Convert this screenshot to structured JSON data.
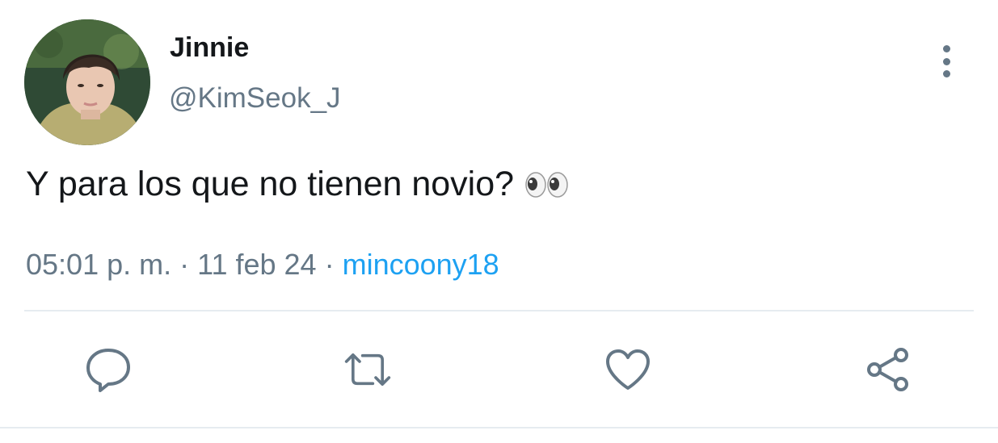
{
  "tweet": {
    "display_name": "Jinnie",
    "handle": "@KimSeok_J",
    "text": "Y para los que no tienen novio?",
    "text_emoji": "eyes-emoji",
    "time": "05:01 p. m.",
    "separator": "·",
    "date": "11 feb 24",
    "via": "mincoony18"
  },
  "icons": {
    "more": "more-vertical-icon",
    "reply": "reply-icon",
    "retweet": "retweet-icon",
    "like": "heart-icon",
    "share": "share-icon"
  },
  "colors": {
    "text": "#14171a",
    "muted": "#657786",
    "link": "#1da1f2",
    "divider": "#e6ecf0"
  }
}
